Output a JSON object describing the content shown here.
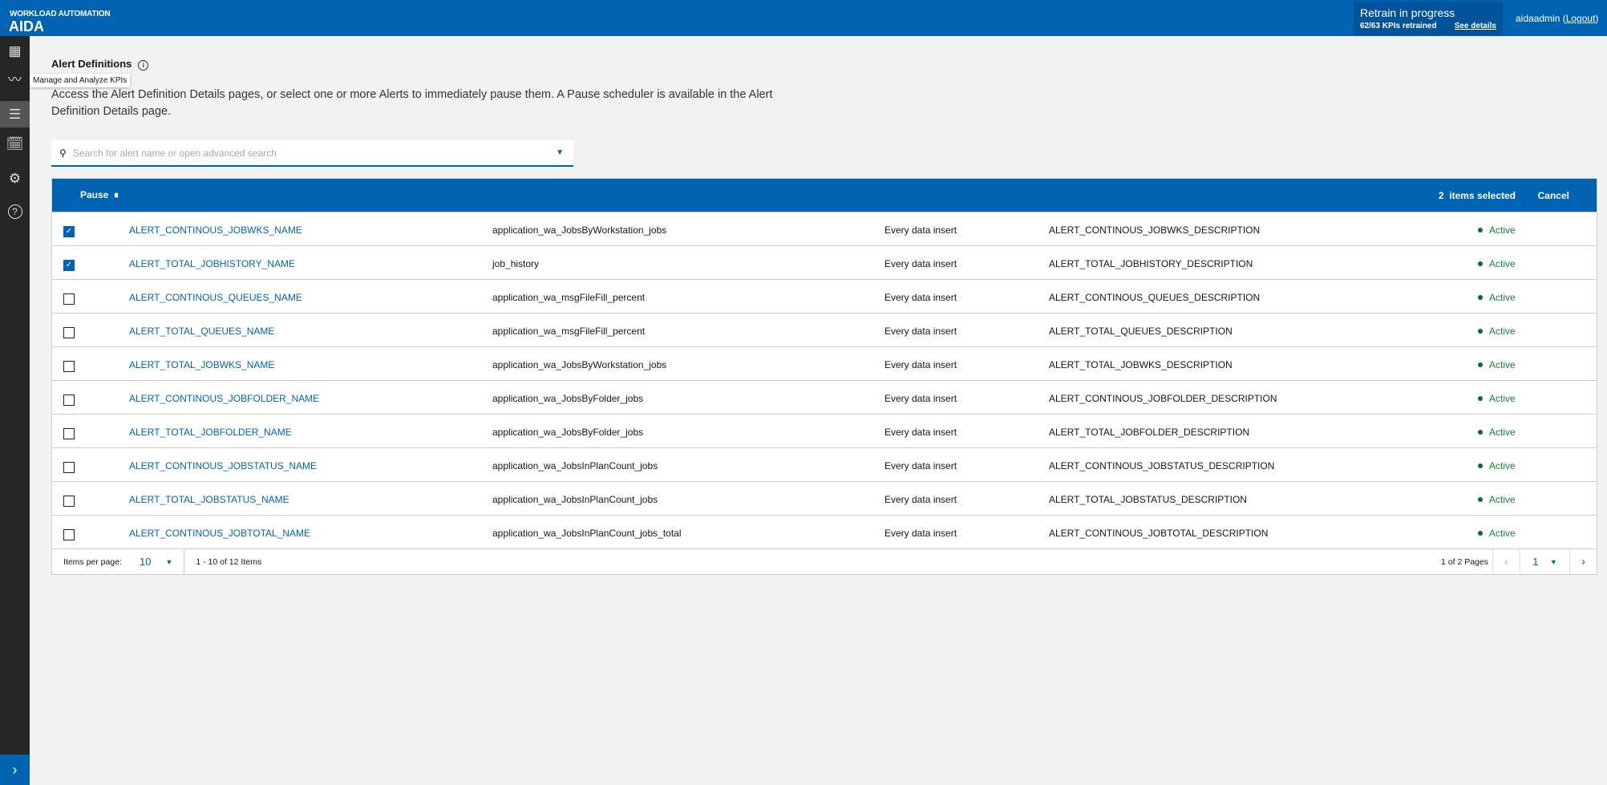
{
  "header": {
    "product": "WORKLOAD AUTOMATION",
    "app": "AIDA",
    "retrain_title": "Retrain in progress",
    "retrain_status": "62/63 KPIs retrained",
    "see_details": "See details",
    "user": "aidaadmin",
    "logout": "Logout"
  },
  "sidebar": {
    "tooltip": "Manage and Analyze KPIs",
    "items": [
      {
        "icon": "dashboard-icon",
        "glyph": "▦"
      },
      {
        "icon": "kpi-icon",
        "glyph": "〰"
      },
      {
        "icon": "alert-list-icon",
        "glyph": "☰"
      },
      {
        "icon": "calendar-gear-icon",
        "glyph": "🗓"
      },
      {
        "icon": "gear-icon",
        "glyph": "⚙"
      },
      {
        "icon": "help-icon",
        "glyph": "?"
      }
    ],
    "expand": "›"
  },
  "page": {
    "title": "Alert Definitions",
    "description": "Access the Alert Definition Details pages, or select one or more Alerts to immediately pause them. A Pause scheduler is available in the Alert Definition Details page."
  },
  "search": {
    "placeholder": "Search for alert name or open advanced search"
  },
  "table": {
    "pause_label": "Pause",
    "selected_count": "2",
    "selected_label": "items selected",
    "cancel_label": "Cancel",
    "rows": [
      {
        "checked": true,
        "name": "ALERT_CONTINOUS_JOBWKS_NAME",
        "metric": "application_wa_JobsByWorkstation_jobs",
        "frequency": "Every data insert",
        "description": "ALERT_CONTINOUS_JOBWKS_DESCRIPTION",
        "status": "Active"
      },
      {
        "checked": true,
        "name": "ALERT_TOTAL_JOBHISTORY_NAME",
        "metric": "job_history",
        "frequency": "Every data insert",
        "description": "ALERT_TOTAL_JOBHISTORY_DESCRIPTION",
        "status": "Active"
      },
      {
        "checked": false,
        "name": "ALERT_CONTINOUS_QUEUES_NAME",
        "metric": "application_wa_msgFileFill_percent",
        "frequency": "Every data insert",
        "description": "ALERT_CONTINOUS_QUEUES_DESCRIPTION",
        "status": "Active"
      },
      {
        "checked": false,
        "name": "ALERT_TOTAL_QUEUES_NAME",
        "metric": "application_wa_msgFileFill_percent",
        "frequency": "Every data insert",
        "description": "ALERT_TOTAL_QUEUES_DESCRIPTION",
        "status": "Active"
      },
      {
        "checked": false,
        "name": "ALERT_TOTAL_JOBWKS_NAME",
        "metric": "application_wa_JobsByWorkstation_jobs",
        "frequency": "Every data insert",
        "description": "ALERT_TOTAL_JOBWKS_DESCRIPTION",
        "status": "Active"
      },
      {
        "checked": false,
        "name": "ALERT_CONTINOUS_JOBFOLDER_NAME",
        "metric": "application_wa_JobsByFolder_jobs",
        "frequency": "Every data insert",
        "description": "ALERT_CONTINOUS_JOBFOLDER_DESCRIPTION",
        "status": "Active"
      },
      {
        "checked": false,
        "name": "ALERT_TOTAL_JOBFOLDER_NAME",
        "metric": "application_wa_JobsByFolder_jobs",
        "frequency": "Every data insert",
        "description": "ALERT_TOTAL_JOBFOLDER_DESCRIPTION",
        "status": "Active"
      },
      {
        "checked": false,
        "name": "ALERT_CONTINOUS_JOBSTATUS_NAME",
        "metric": "application_wa_JobsInPlanCount_jobs",
        "frequency": "Every data insert",
        "description": "ALERT_CONTINOUS_JOBSTATUS_DESCRIPTION",
        "status": "Active"
      },
      {
        "checked": false,
        "name": "ALERT_TOTAL_JOBSTATUS_NAME",
        "metric": "application_wa_JobsInPlanCount_jobs",
        "frequency": "Every data insert",
        "description": "ALERT_TOTAL_JOBSTATUS_DESCRIPTION",
        "status": "Active"
      },
      {
        "checked": false,
        "name": "ALERT_CONTINOUS_JOBTOTAL_NAME",
        "metric": "application_wa_JobsInPlanCount_jobs_total",
        "frequency": "Every data insert",
        "description": "ALERT_CONTINOUS_JOBTOTAL_DESCRIPTION",
        "status": "Active"
      }
    ]
  },
  "pagination": {
    "items_per_page_label": "Items per page:",
    "items_per_page": "10",
    "range": "1 - 10 of 12 Items",
    "pages": "1 of 2 Pages",
    "current_page": "1"
  },
  "colors": {
    "brand": "#0063b1",
    "active": "#198038"
  }
}
